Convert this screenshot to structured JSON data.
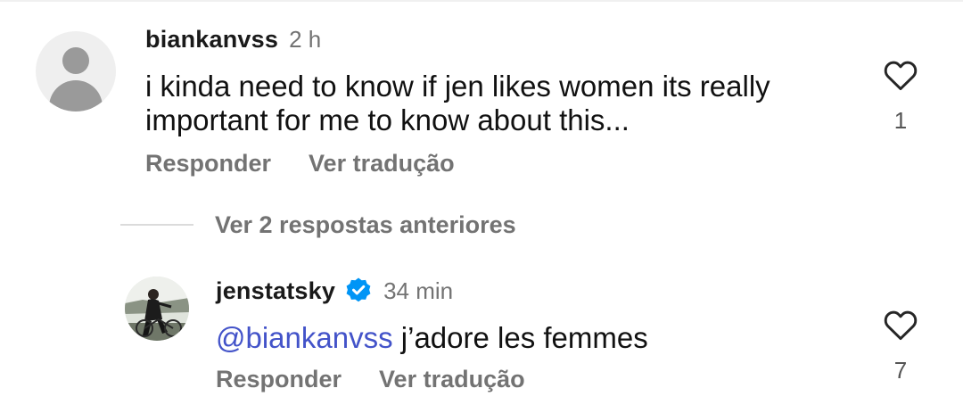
{
  "comments": [
    {
      "username": "biankanvss",
      "timestamp": "2 h",
      "text": "i kinda need to know if jen likes women its really important for me to know about this...",
      "reply_label": "Responder",
      "translate_label": "Ver tradução",
      "like_count": "1",
      "avatar": "default-avatar-icon"
    },
    {
      "username": "jenstatsky",
      "verified": true,
      "timestamp": "34 min",
      "mention": "@biankanvss",
      "text": "j’adore les femmes",
      "reply_label": "Responder",
      "translate_label": "Ver tradução",
      "like_count": "7",
      "avatar": "profile-photo"
    }
  ],
  "view_replies_label": "Ver 2 respostas anteriores",
  "icons": {
    "like": "heart-outline-icon",
    "verified": "verified-badge-icon"
  },
  "colors": {
    "mention": "#4353c9",
    "verified": "#0095f6",
    "secondary_text": "#737373"
  }
}
